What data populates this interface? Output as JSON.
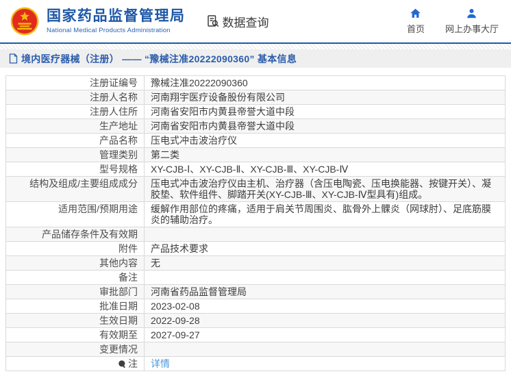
{
  "header": {
    "agency_name_cn": "国家药品监督管理局",
    "agency_name_en": "National Medical Products Administration",
    "section_title": "数据查询",
    "nav": [
      {
        "id": "home",
        "label": "首页",
        "icon": "home-icon"
      },
      {
        "id": "service-hall",
        "label": "网上办事大厅",
        "icon": "person-icon"
      }
    ]
  },
  "breadcrumb": {
    "text": "境内医疗器械（注册） —— “豫械注准20222090360” 基本信息"
  },
  "table": {
    "rows": [
      {
        "label": "注册证编号",
        "value": "豫械注准20222090360"
      },
      {
        "label": "注册人名称",
        "value": "河南翔宇医疗设备股份有限公司"
      },
      {
        "label": "注册人住所",
        "value": "河南省安阳市内黄县帝誉大道中段"
      },
      {
        "label": "生产地址",
        "value": "河南省安阳市内黄县帝誉大道中段"
      },
      {
        "label": "产品名称",
        "value": "压电式冲击波治疗仪"
      },
      {
        "label": "管理类别",
        "value": "第二类"
      },
      {
        "label": "型号规格",
        "value": "XY-CJB-Ⅰ、XY-CJB-Ⅱ、XY-CJB-Ⅲ、XY-CJB-Ⅳ"
      },
      {
        "label": "结构及组成/主要组成成分",
        "value": "压电式冲击波治疗仪由主机、治疗器（含压电陶瓷、压电换能器、按键开关）、凝胶垫、软件组件、脚踏开关(XY-CJB-Ⅲ、XY-CJB-Ⅳ型具有)组成。"
      },
      {
        "label": "适用范围/预期用途",
        "value": "缓解作用部位的疼痛，适用于肩关节周围炎、肱骨外上髁炎（网球肘）、足底筋膜炎的辅助治疗。"
      },
      {
        "label": "产品储存条件及有效期",
        "value": ""
      },
      {
        "label": "附件",
        "value": "产品技术要求"
      },
      {
        "label": "其他内容",
        "value": "无"
      },
      {
        "label": "备注",
        "value": ""
      },
      {
        "label": "审批部门",
        "value": "河南省药品监督管理局"
      },
      {
        "label": "批准日期",
        "value": "2023-02-08"
      },
      {
        "label": "生效日期",
        "value": "2022-09-28"
      },
      {
        "label": "有效期至",
        "value": "2027-09-27"
      },
      {
        "label": "变更情况",
        "value": ""
      },
      {
        "label": "注",
        "value": "详情",
        "link": true,
        "label_icon": "note-icon"
      }
    ]
  },
  "colors": {
    "title_blue": "#1d57a7",
    "rule_blue": "#1b5aa7",
    "nav_icon_blue": "#2468d4",
    "breadcrumb_blue": "#2b5cab",
    "link_blue": "#4b96dd",
    "bar_gray": "#efefef",
    "row_alt_gray": "#f7f7f7",
    "border_gray": "#d9d9d9",
    "emblem_red": "#e02b1d",
    "emblem_gold": "#f5b90f"
  }
}
